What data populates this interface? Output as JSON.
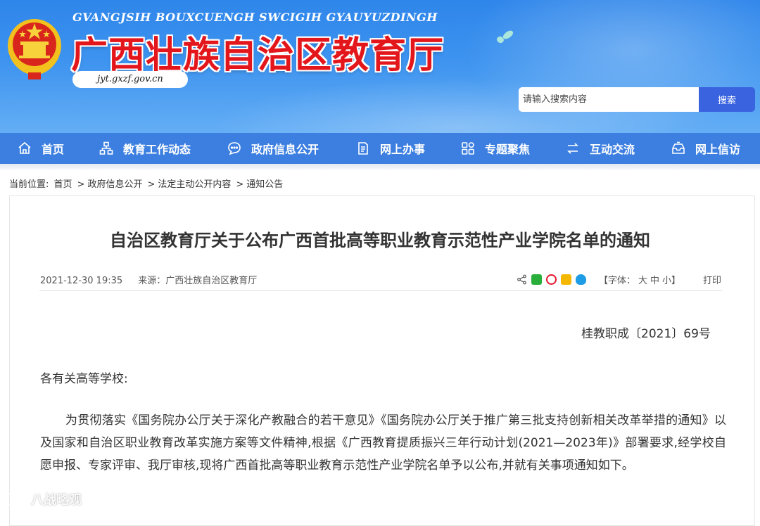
{
  "header": {
    "pinyin_name": "GVANGJSIH BOUXCUENGH SWCIGIH GYAUYUZDINGH",
    "site_title": "广西壮族自治区教育厅",
    "site_url": "jyt.gxzf.gov.cn",
    "emblem_icon": "national-emblem-icon",
    "search": {
      "placeholder": "请输入搜索内容",
      "button_label": "搜索"
    }
  },
  "nav": {
    "items": [
      {
        "label": "首页",
        "icon": "home-icon"
      },
      {
        "label": "教育工作动态",
        "icon": "network-icon"
      },
      {
        "label": "政府信息公开",
        "icon": "chat-icon"
      },
      {
        "label": "网上办事",
        "icon": "document-icon"
      },
      {
        "label": "专题聚焦",
        "icon": "grid-icon"
      },
      {
        "label": "互动交流",
        "icon": "exchange-icon"
      },
      {
        "label": "网上信访",
        "icon": "inbox-icon"
      }
    ]
  },
  "breadcrumb": {
    "prefix": "当前位置:",
    "items": [
      "首页",
      "政府信息公开",
      "法定主动公开内容",
      "通知公告"
    ],
    "separator": ">"
  },
  "article": {
    "title": "自治区教育厅关于公布广西首批高等职业教育示范性产业学院名单的通知",
    "date": "2021-12-30 19:35",
    "source": "来源：广西壮族自治区教育厅",
    "share_icons": [
      "share-icon",
      "wechat-icon",
      "weibo-icon",
      "qzone-icon",
      "qq-icon"
    ],
    "font_size": {
      "label": "【字体：",
      "large": "大",
      "medium": "中",
      "small": "小】"
    },
    "print_label": "打印",
    "doc_number": "桂教职成〔2021〕69号",
    "salutation": "各有关高等学校:",
    "paragraph": "为贯彻落实《国务院办公厅关于深化产教融合的若干意见》《国务院办公厅关于推广第三批支持创新相关改革举措的通知》以及国家和自治区职业教育改革实施方案等文件精神,根据《广西教育提质振兴三年行动计划(2021—2023年)》部署要求,经学校自愿申报、专家评审、我厅审核,现将广西首批高等职业教育示范性产业学院名单予以公布,并就有关事项通知如下。"
  },
  "watermark": {
    "text": "八战略观",
    "icon": "logo-icon"
  },
  "colors": {
    "header_blue": "#2f86ea",
    "nav_blue": "#3c7fe0",
    "title_red": "#e3171b",
    "search_button": "#3a63e0"
  }
}
